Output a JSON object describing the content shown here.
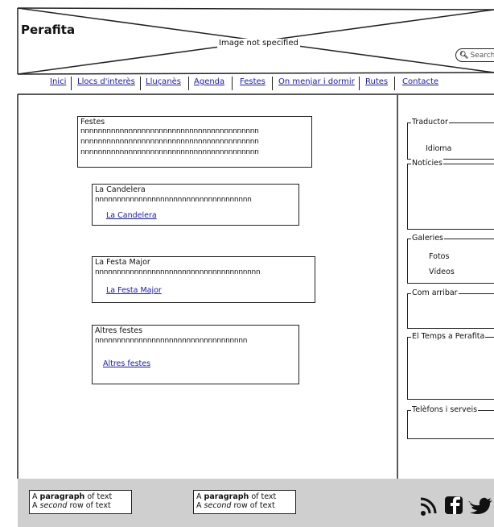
{
  "header": {
    "logo": "Perafita",
    "image_placeholder": "Image not specified",
    "search_placeholder": "Search"
  },
  "nav": {
    "items": [
      {
        "label": "Inici"
      },
      {
        "label": "Llocs d'interès"
      },
      {
        "label": "Lluçanès"
      },
      {
        "label": "Agenda"
      },
      {
        "label": "Festes"
      },
      {
        "label": "On menjar i dormir"
      },
      {
        "label": "Rutes"
      },
      {
        "label": "Contacte"
      }
    ]
  },
  "main": {
    "intro": {
      "title": "Festes",
      "lines": [
        "nnnnnnnnnnnnnnnnnnnnnnnnnnnnnnnnnnnnnnnnn",
        "nnnnnnnnnnnnnnnnnnnnnnnnnnnnnnnnnnnnnnnnn",
        "nnnnnnnnnnnnnnnnnnnnnnnnnnnnnnnnnnnnnnnnn"
      ]
    },
    "events": [
      {
        "title": "La Candelera",
        "text": "nnnnnnnnnnnnnnnnnnnnnnnnnnnnnnnnnnnn",
        "link": "La Candelera"
      },
      {
        "title": "La Festa Major",
        "text": "nnnnnnnnnnnnnnnnnnnnnnnnnnnnnnnnnnnnnn",
        "link": "La Festa Major"
      },
      {
        "title": "Altres festes",
        "text": "nnnnnnnnnnnnnnnnnnnnnnnnnnnnnnnnnnn",
        "link": "Altres festes"
      }
    ]
  },
  "sidebar": {
    "traductor": {
      "title": "Traductor",
      "item": "Idioma"
    },
    "noticies": {
      "title": "Notícies"
    },
    "galeries": {
      "title": "Galeries",
      "items": [
        "Fotos",
        "Vídeos"
      ]
    },
    "com_arribar": {
      "title": "Com arribar"
    },
    "temps": {
      "title": "El Temps a Perafita"
    },
    "telefons": {
      "title": "Telèfons i serveis"
    }
  },
  "footer": {
    "boxes": [
      {
        "line1_pre": "A ",
        "line1_bold": "paragraph",
        "line1_post": " of text",
        "line2_pre": "A ",
        "line2_italic": "second",
        "line2_post": " row of text"
      },
      {
        "line1_pre": "A ",
        "line1_bold": "paragraph",
        "line1_post": " of text",
        "line2_pre": "A ",
        "line2_italic": "second",
        "line2_post": " row of text"
      }
    ],
    "social_icons": [
      "rss-icon",
      "facebook-icon",
      "twitter-icon"
    ]
  }
}
